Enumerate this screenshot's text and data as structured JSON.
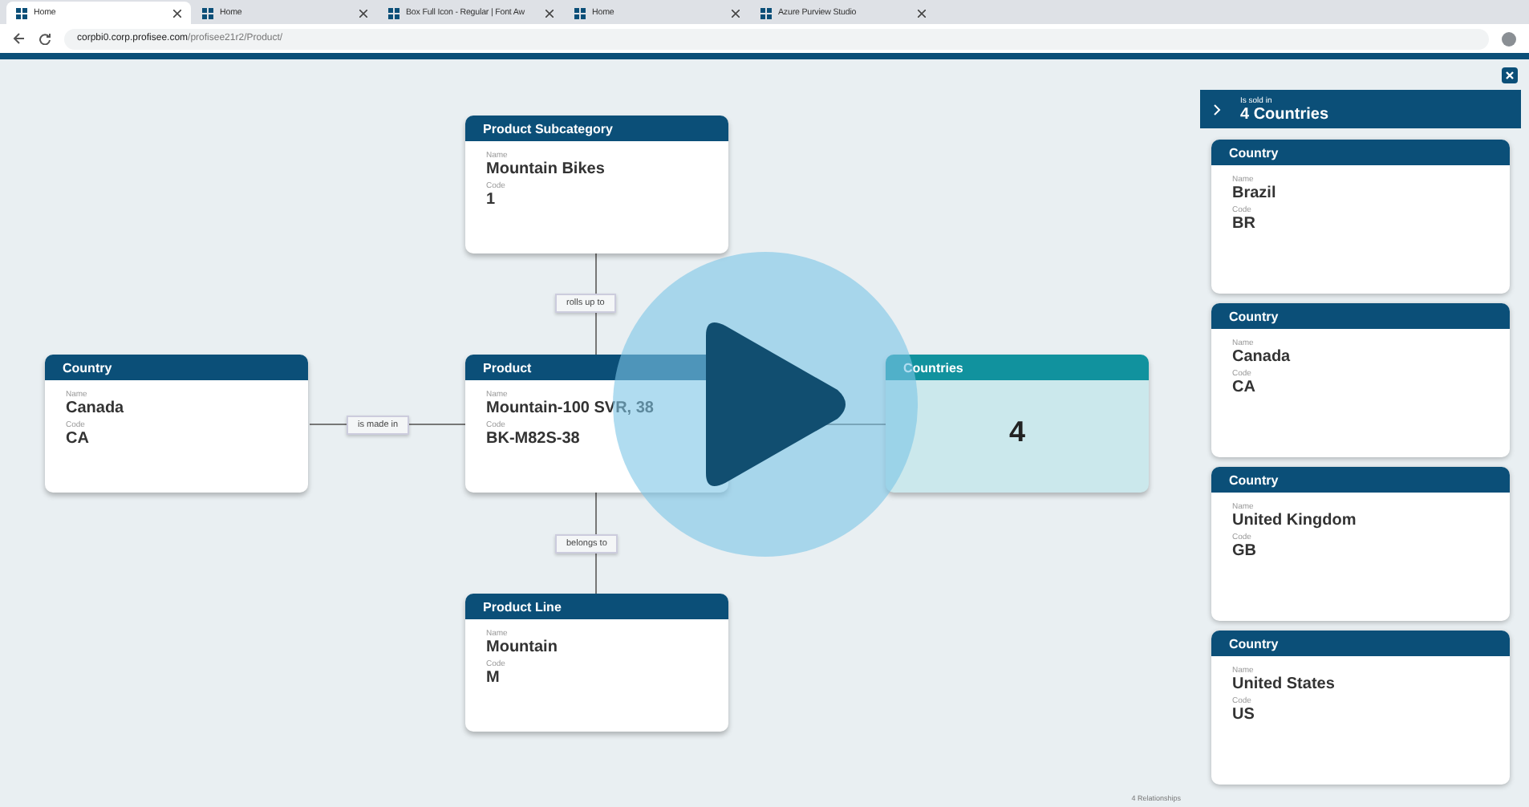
{
  "browser": {
    "tabs": [
      {
        "title": "Home",
        "selected": true
      },
      {
        "title": "Home",
        "selected": false
      },
      {
        "title": "Box Full Icon - Regular | Font Aw",
        "selected": false
      },
      {
        "title": "Home",
        "selected": false
      },
      {
        "title": "Azure Purview Studio",
        "selected": false
      }
    ],
    "url_host": "corpbi0.corp.profisee.com",
    "url_path": "/profisee21r2/Product/"
  },
  "diagram": {
    "nodes": [
      {
        "kind": "entity",
        "title": "Product Subcategory",
        "fields": [
          {
            "label": "Name",
            "value": "Mountain Bikes"
          },
          {
            "label": "Code",
            "value": "1"
          }
        ]
      },
      {
        "kind": "entity",
        "title": "Country",
        "fields": [
          {
            "label": "Name",
            "value": "Canada"
          },
          {
            "label": "Code",
            "value": "CA"
          }
        ]
      },
      {
        "kind": "entity",
        "title": "Product",
        "fields": [
          {
            "label": "Name",
            "value": "Mountain-100 SVR, 38"
          },
          {
            "label": "Code",
            "value": "BK-M82S-38"
          }
        ]
      },
      {
        "kind": "count",
        "title": "Countries",
        "value": "4"
      },
      {
        "kind": "entity",
        "title": "Product Line",
        "fields": [
          {
            "label": "Name",
            "value": "Mountain"
          },
          {
            "label": "Code",
            "value": "M"
          }
        ]
      }
    ],
    "edges": [
      {
        "label": "rolls up to"
      },
      {
        "label": "is made in"
      },
      {
        "label": "belongs to"
      }
    ],
    "footer": "4 Relationships"
  },
  "panel": {
    "subtitle": "Is sold in",
    "title": "4 Countries",
    "cards": [
      {
        "title": "Country",
        "fields": [
          {
            "label": "Name",
            "value": "Brazil"
          },
          {
            "label": "Code",
            "value": "BR"
          }
        ]
      },
      {
        "title": "Country",
        "fields": [
          {
            "label": "Name",
            "value": "Canada"
          },
          {
            "label": "Code",
            "value": "CA"
          }
        ]
      },
      {
        "title": "Country",
        "fields": [
          {
            "label": "Name",
            "value": "United Kingdom"
          },
          {
            "label": "Code",
            "value": "GB"
          }
        ]
      },
      {
        "title": "Country",
        "fields": [
          {
            "label": "Name",
            "value": "United States"
          },
          {
            "label": "Code",
            "value": "US"
          }
        ]
      }
    ]
  }
}
